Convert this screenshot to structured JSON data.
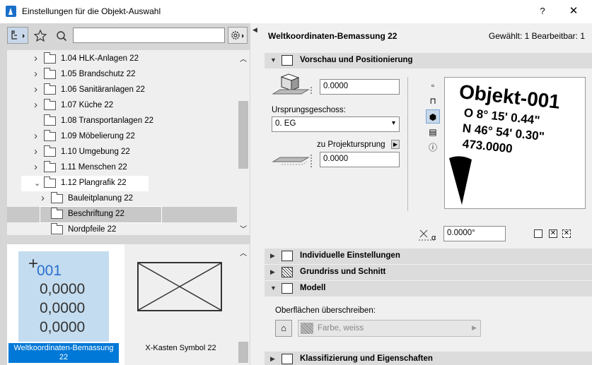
{
  "window": {
    "title": "Einstellungen für die Objekt-Auswahl",
    "help": "?",
    "close": "✕"
  },
  "tree": {
    "items": [
      {
        "label": "1.04 HLK-Anlagen 22",
        "expandable": true
      },
      {
        "label": "1.05 Brandschutz 22",
        "expandable": true
      },
      {
        "label": "1.06 Sanitäranlagen 22",
        "expandable": true
      },
      {
        "label": "1.07 Küche 22",
        "expandable": true
      },
      {
        "label": "1.08 Transportanlagen 22",
        "expandable": false
      },
      {
        "label": "1.09 Möbelierung 22",
        "expandable": true
      },
      {
        "label": "1.10 Umgebung 22",
        "expandable": true
      },
      {
        "label": "1.11 Menschen 22",
        "expandable": true
      },
      {
        "label": "1.12 Plangrafik 22",
        "expandable": true,
        "expanded": true
      },
      {
        "label": "Bauleitplanung 22",
        "expandable": true
      },
      {
        "label": "Beschriftung 22",
        "expandable": false,
        "selected": true
      },
      {
        "label": "Nordpfeile 22",
        "expandable": false
      }
    ]
  },
  "preview": {
    "item1": {
      "caption": "Weltkoordinaten-Bemassung 22",
      "thumb_lines": [
        "001",
        "0,0000",
        "0,0000",
        "0,0000"
      ]
    },
    "item2": {
      "caption": "X-Kasten Symbol 22"
    }
  },
  "right": {
    "title": "Weltkoordinaten-Bemassung 22",
    "status": "Gewählt: 1 Bearbeitbar: 1",
    "sections": {
      "vorschau": "Vorschau und Positionierung",
      "individuelle": "Individuelle Einstellungen",
      "grundriss": "Grundriss und Schnitt",
      "modell": "Modell",
      "klassifizierung": "Klassifizierung und Eigenschaften"
    },
    "height_value": "0.0000",
    "ursprung_label": "Ursprungsgeschoss:",
    "ursprung_value": "0. EG",
    "projekt_label": "zu Projektursprung",
    "projekt_value": "0.0000",
    "angle_value": "0.0000°",
    "angle_symbol": "α",
    "preview_text": {
      "name": "Objekt-001",
      "line1": "O 8° 15' 0.44\"",
      "line2": "N 46° 54' 0.30\"",
      "line3": "473.0000"
    },
    "oberflaechen_label": "Oberflächen überschreiben:",
    "oberflaechen_value": "Farbe, weiss"
  },
  "colors": {
    "selection": "#0078d7",
    "thumb_bg": "#c4dcef",
    "thumb_text": "#2a6fd0"
  }
}
